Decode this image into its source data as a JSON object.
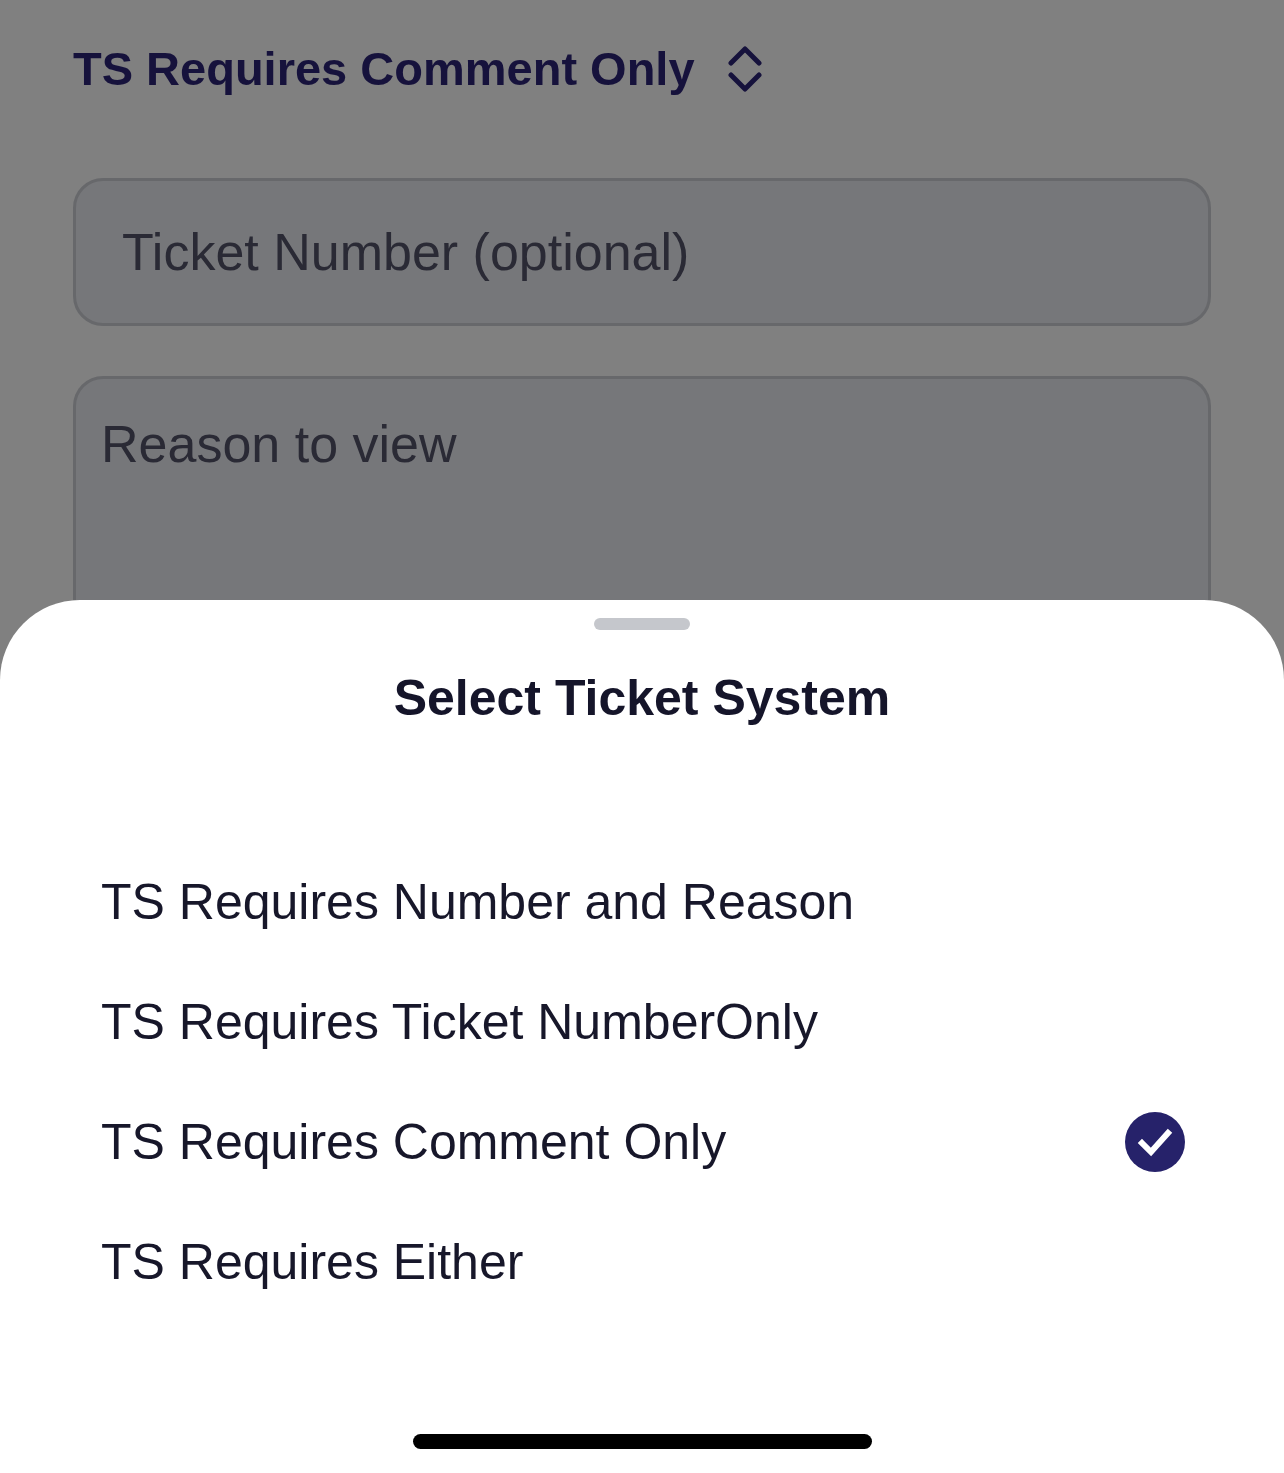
{
  "header": {
    "picker_label": "TS Requires Comment Only"
  },
  "form": {
    "fields": [
      {
        "kind": "single_line",
        "placeholder": "Ticket Number (optional)"
      },
      {
        "kind": "multi_line",
        "placeholder": "Reason to view"
      }
    ]
  },
  "sheet": {
    "title": "Select Ticket System",
    "options": [
      {
        "label": "TS Requires Number and Reason",
        "selected": false
      },
      {
        "label": "TS Requires Ticket NumberOnly",
        "selected": false
      },
      {
        "label": "TS Requires Comment Only",
        "selected": true
      },
      {
        "label": "TS Requires Either",
        "selected": false
      }
    ]
  }
}
